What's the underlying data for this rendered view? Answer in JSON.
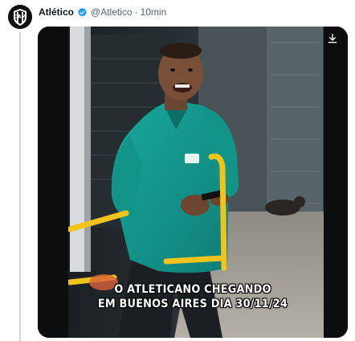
{
  "tweet": {
    "author_name": "Atlético",
    "handle": "@Atletico",
    "separator": "·",
    "time": "10min"
  },
  "media": {
    "caption_line1": "O ATLETICANO CHEGANDO",
    "caption_line2": "EM BUENOS AIRES DIA 30/11/24"
  },
  "icons": {
    "avatar": "atletico-crest-icon",
    "verified": "verified-badge-icon",
    "download": "download-icon"
  },
  "colors": {
    "verified": "#1d9bf0",
    "secondary_text": "#536471",
    "shirt": "#149c93",
    "railing": "#f2c31b"
  }
}
